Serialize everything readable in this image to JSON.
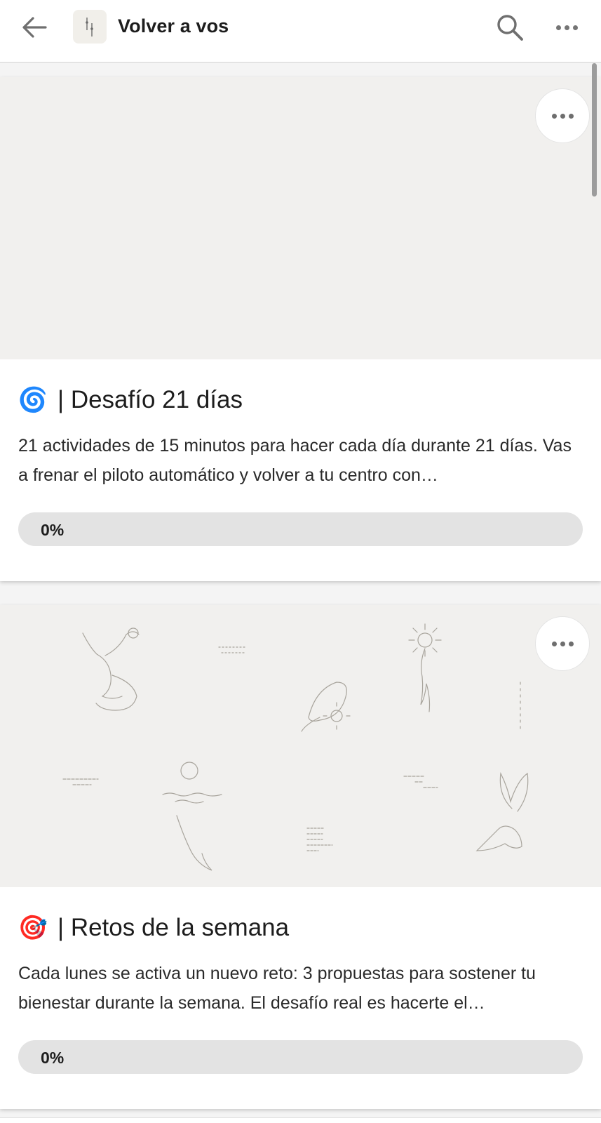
{
  "header": {
    "back_icon": "arrow-left-icon",
    "logo_icon": "app-logo-icon",
    "title": "Volver a vos",
    "search_icon": "search-icon",
    "more_icon": "more-horizontal-icon"
  },
  "cards": [
    {
      "emoji": "🌀",
      "title": "| Desafío 21 días",
      "description": "21 actividades de 15 minutos para hacer cada día durante 21 días. Vas a frenar el piloto automático y volver a tu centro con…",
      "progress_label": "0%",
      "progress_value": 0,
      "more_icon": "more-horizontal-icon"
    },
    {
      "emoji": "🎯",
      "title": "| Retos de la semana",
      "description": "Cada lunes se activa un nuevo reto: 3 propuestas para sostener tu bienestar durante la semana. El desafío real es hacerte el…",
      "progress_label": "0%",
      "progress_value": 0,
      "more_icon": "more-horizontal-icon",
      "cover_texts": [
        "always be my baby",
        "sunshine",
        "wish upon a star",
        "under the sea",
        "SUGAR SPICE AND EVERYTHING NICE"
      ]
    }
  ],
  "colors": {
    "background": "#f4f4f4",
    "card": "#ffffff",
    "cover": "#f1f0ee",
    "progress_track": "#e3e3e3",
    "text": "#1d1d1d"
  }
}
